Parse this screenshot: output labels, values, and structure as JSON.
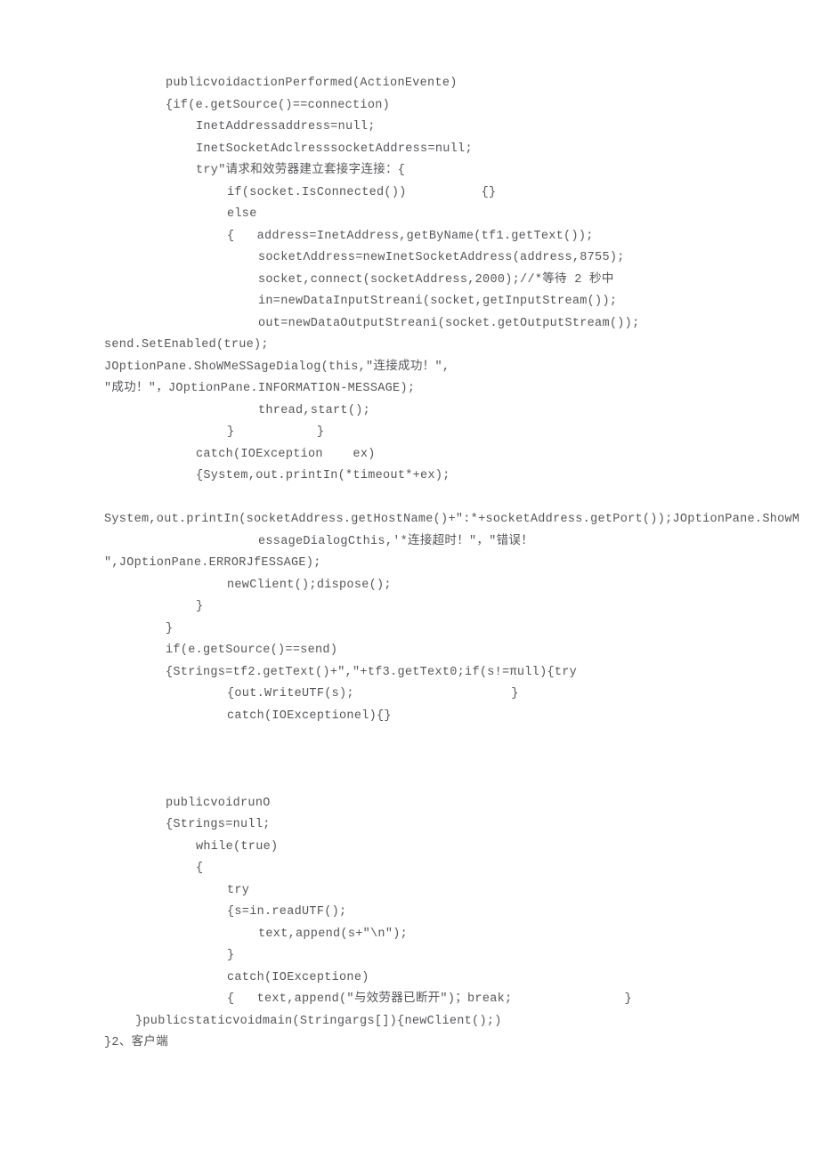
{
  "lines": [
    {
      "indent": 186,
      "text": "publicvoidactionPerformed(ActionEvente)"
    },
    {
      "indent": 186,
      "text": "{if(e.getSource()==connection)"
    },
    {
      "indent": 220,
      "text": "InetAddressaddress=null;"
    },
    {
      "indent": 220,
      "text": "InetSocketAdclresssocketAddress=null;"
    },
    {
      "indent": 220,
      "text": "try\"请求和效劳器建立套接字连接：{"
    },
    {
      "indent": 255,
      "text": "if(socket.IsConnected())          {}"
    },
    {
      "indent": 255,
      "text": "else"
    },
    {
      "indent": 255,
      "text": "{   address=InetAddress,getByName(tf1.getText());"
    },
    {
      "indent": 290,
      "text": "socketΛddress=newInetSocketAddress(address,8755);"
    },
    {
      "indent": 290,
      "text": "socket,connect(socketAddress,2000);//*等待 2 秒中"
    },
    {
      "indent": 290,
      "text": "in=newDataInputStreani(socket,getInputStream());"
    },
    {
      "indent": 290,
      "text": "out=newDataOutputStreani(socket.getOutputStream());"
    },
    {
      "indent": 117,
      "text": "send.SetEnabled(true);"
    },
    {
      "indent": 117,
      "text": "JOptionPane.ShoWMeSSageDialog(this,\"连接成功！\","
    },
    {
      "indent": 117,
      "text": "\"成功！\"，JOptionPane.INFORMATION-MESSAGE);"
    },
    {
      "indent": 290,
      "text": "thread,start();"
    },
    {
      "indent": 255,
      "text": "}           }"
    },
    {
      "indent": 220,
      "text": "catch(IOException    ex)"
    },
    {
      "indent": 220,
      "text": "{System,out.printIn(*timeout*+ex);"
    },
    {
      "indent": 0,
      "text": ""
    },
    {
      "indent": 117,
      "text": "System,out.printIn(socketAddress.getHostName()+\":*+socketAddress.getPort());JOptionPane.ShowM"
    },
    {
      "indent": 290,
      "text": "essageDialogCthis,'*连接超时！\"，\"错误！"
    },
    {
      "indent": 117,
      "text": "\",JOptionPane.ERRORJfESSAGE);"
    },
    {
      "indent": 255,
      "text": "newClient();dispose();"
    },
    {
      "indent": 220,
      "text": "}"
    },
    {
      "indent": 186,
      "text": "}"
    },
    {
      "indent": 186,
      "text": "if(e.getSource()==send)"
    },
    {
      "indent": 186,
      "text": "{Strings=tf2.getText()+\",\"+tf3.getText0;if(s!=πull){try"
    },
    {
      "indent": 255,
      "text": "{out.WriteUTF(s);                     }"
    },
    {
      "indent": 255,
      "text": "catch(IOExceptionel){}"
    },
    {
      "indent": 0,
      "text": ""
    },
    {
      "indent": 0,
      "text": ""
    },
    {
      "indent": 0,
      "text": ""
    },
    {
      "indent": 186,
      "text": "publicvoidrunO"
    },
    {
      "indent": 186,
      "text": "{Strings=null;"
    },
    {
      "indent": 220,
      "text": "while(true)"
    },
    {
      "indent": 220,
      "text": "{"
    },
    {
      "indent": 255,
      "text": "try"
    },
    {
      "indent": 255,
      "text": "{s=in.readUTF();"
    },
    {
      "indent": 290,
      "text": "text,append(s+\"\\n\");"
    },
    {
      "indent": 255,
      "text": "}"
    },
    {
      "indent": 255,
      "text": "catch(IOExceptione)"
    },
    {
      "indent": 255,
      "text": "{   text,append(\"与效劳器已断开\")；break;               }"
    },
    {
      "indent": 152,
      "text": "}publicstaticvoidmain(Stringargs[]){newClient();)"
    },
    {
      "indent": 117,
      "text": "}2、客户端"
    }
  ]
}
